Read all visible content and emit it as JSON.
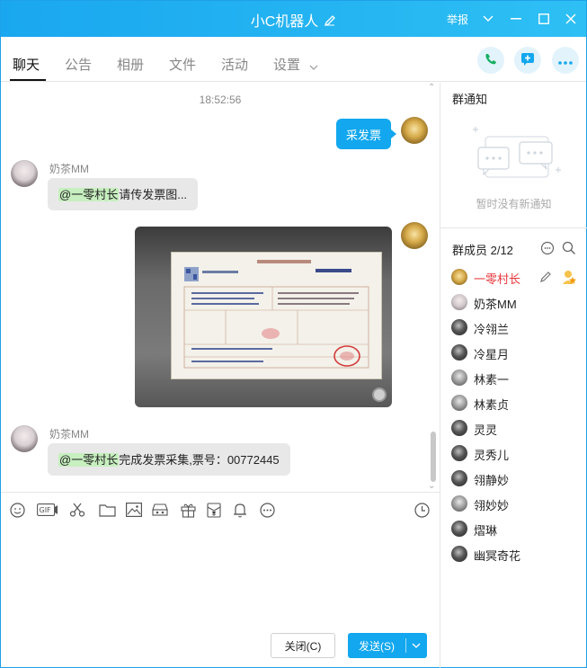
{
  "window": {
    "title": "小C机器人",
    "report_label": "举报"
  },
  "tabs": [
    {
      "label": "聊天",
      "active": true
    },
    {
      "label": "公告"
    },
    {
      "label": "相册"
    },
    {
      "label": "文件"
    },
    {
      "label": "活动"
    },
    {
      "label": "设置"
    }
  ],
  "chat": {
    "timestamp": "18:52:56",
    "messages": [
      {
        "direction": "out",
        "text": "采发票"
      },
      {
        "direction": "in",
        "sender": "奶茶MM",
        "mention": "@一零村长",
        "text": "请传发票图..."
      },
      {
        "direction": "out",
        "type": "image",
        "image_caption": "invoice"
      },
      {
        "direction": "in",
        "sender": "奶茶MM",
        "mention": "@一零村长",
        "text": "完成发票采集,票号：00772445"
      }
    ]
  },
  "toolbar": {
    "gif_label": "GIF"
  },
  "buttons": {
    "close_label": "关闭(C)",
    "send_label": "发送(S)"
  },
  "notice": {
    "title": "群通知",
    "empty_text": "暂时没有新通知"
  },
  "members": {
    "title": "群成员 2/12",
    "list": [
      {
        "name": "一零村长",
        "owner": true,
        "avatar": "gold"
      },
      {
        "name": "奶茶MM",
        "avatar": "girl"
      },
      {
        "name": "冷翎兰",
        "avatar": "dark"
      },
      {
        "name": "冷星月",
        "avatar": "dark"
      },
      {
        "name": "林素一",
        "avatar": "grey"
      },
      {
        "name": "林素贞",
        "avatar": "grey"
      },
      {
        "name": "灵灵",
        "avatar": "dark"
      },
      {
        "name": "灵秀儿",
        "avatar": "dark"
      },
      {
        "name": "翎静妙",
        "avatar": "dark"
      },
      {
        "name": "翎妙妙",
        "avatar": "grey"
      },
      {
        "name": "熠琳",
        "avatar": "dark"
      },
      {
        "name": "幽冥奇花",
        "avatar": "dark"
      }
    ]
  },
  "colors": {
    "accent": "#12a7ee",
    "owner_name": "#e8363a",
    "mention_bg": "#c7efbf",
    "bubble_in": "#e8e8e8"
  }
}
